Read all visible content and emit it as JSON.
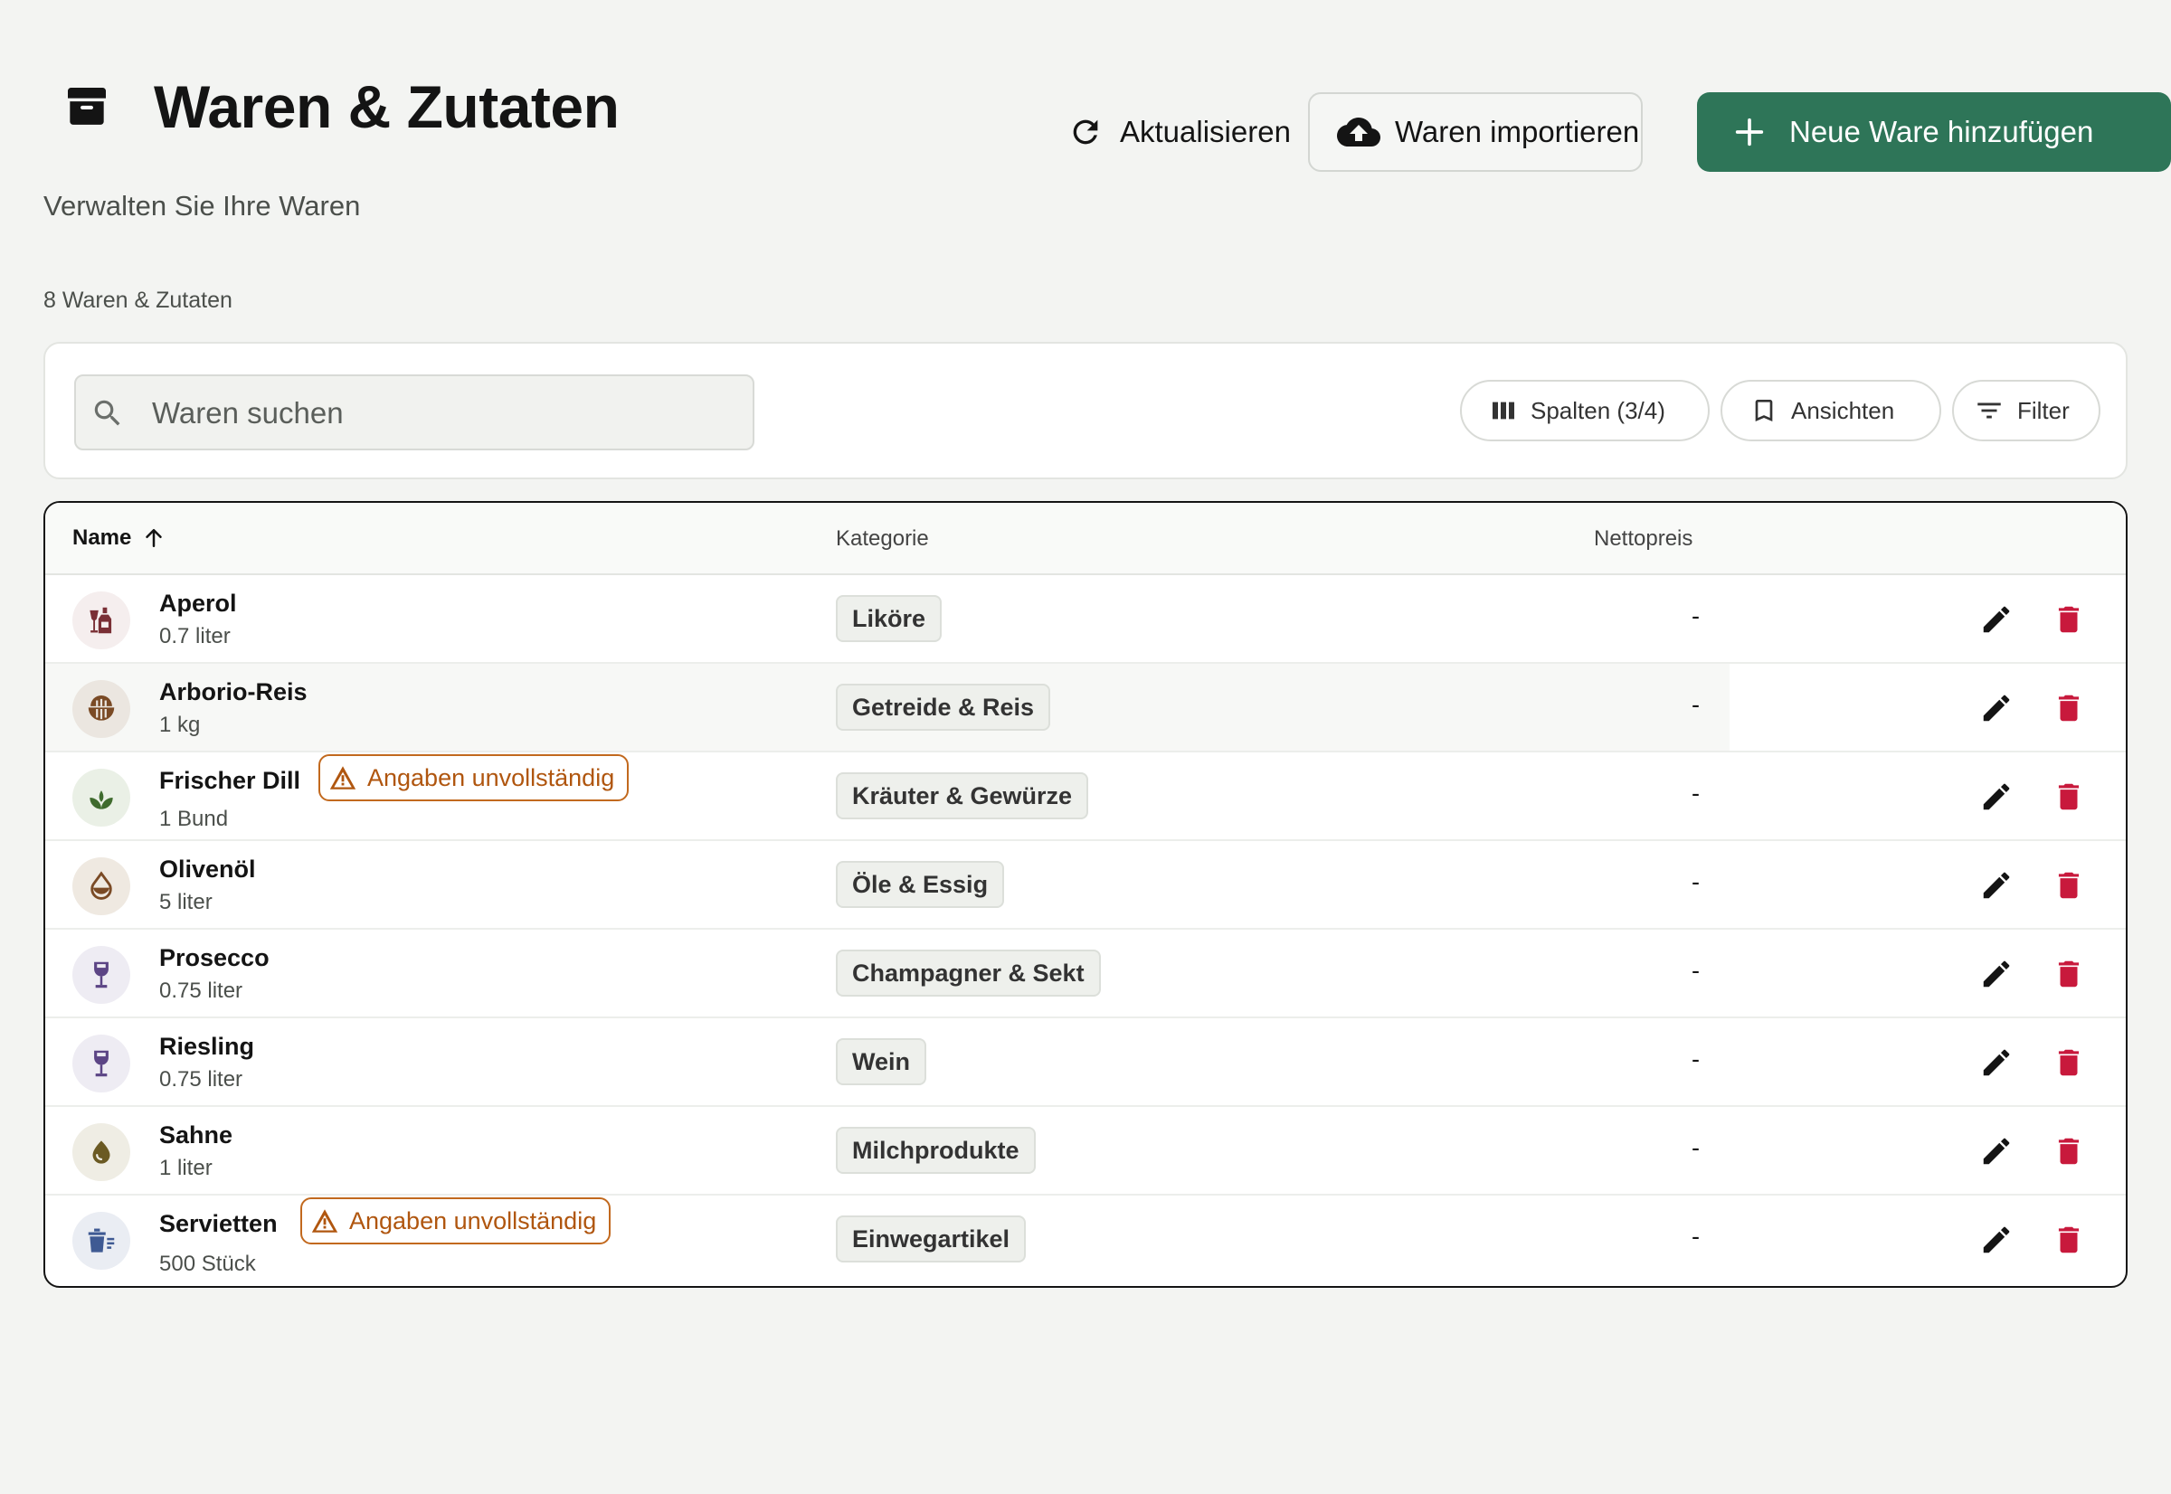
{
  "header": {
    "title": "Waren & Zutaten",
    "subtitle": "Verwalten Sie Ihre Waren",
    "refresh_label": "Aktualisieren",
    "import_label": "Waren importieren",
    "new_label": "Neue Ware hinzufügen"
  },
  "summary": {
    "count_label": "8 Waren & Zutaten"
  },
  "toolbar": {
    "search_placeholder": "Waren suchen",
    "columns_label": "Spalten (3/4)",
    "views_label": "Ansichten",
    "filter_label": "Filter"
  },
  "table": {
    "headers": {
      "name": "Name",
      "category": "Kategorie",
      "price": "Nettopreis"
    },
    "rows": [
      {
        "name": "Aperol",
        "qty": "0.7 liter",
        "category": "Liköre",
        "price": "-",
        "icon": "liquor-bottle-icon",
        "warning": ""
      },
      {
        "name": "Arborio-Reis",
        "qty": "1 kg",
        "category": "Getreide & Reis",
        "price": "-",
        "icon": "rice-bowl-icon",
        "warning": ""
      },
      {
        "name": "Frischer Dill",
        "qty": "1 Bund",
        "category": "Kräuter & Gewürze",
        "price": "-",
        "icon": "herb-leaf-icon",
        "warning": "Angaben unvollständig"
      },
      {
        "name": "Olivenöl",
        "qty": "5 liter",
        "category": "Öle & Essig",
        "price": "-",
        "icon": "oil-drop-icon",
        "warning": ""
      },
      {
        "name": "Prosecco",
        "qty": "0.75 liter",
        "category": "Champagner & Sekt",
        "price": "-",
        "icon": "wine-glass-icon",
        "warning": ""
      },
      {
        "name": "Riesling",
        "qty": "0.75 liter",
        "category": "Wein",
        "price": "-",
        "icon": "wine-glass-icon",
        "warning": ""
      },
      {
        "name": "Sahne",
        "qty": "1 liter",
        "category": "Milchprodukte",
        "price": "-",
        "icon": "cream-drop-icon",
        "warning": ""
      },
      {
        "name": "Servietten",
        "qty": "500 Stück",
        "category": "Einwegartikel",
        "price": "-",
        "icon": "disposable-cup-icon",
        "warning": "Angaben unvollständig"
      }
    ]
  },
  "colors": {
    "accent": "#2e7558",
    "warning": "#b0560f",
    "delete": "#c8193c",
    "background": "#f3f4f2"
  }
}
